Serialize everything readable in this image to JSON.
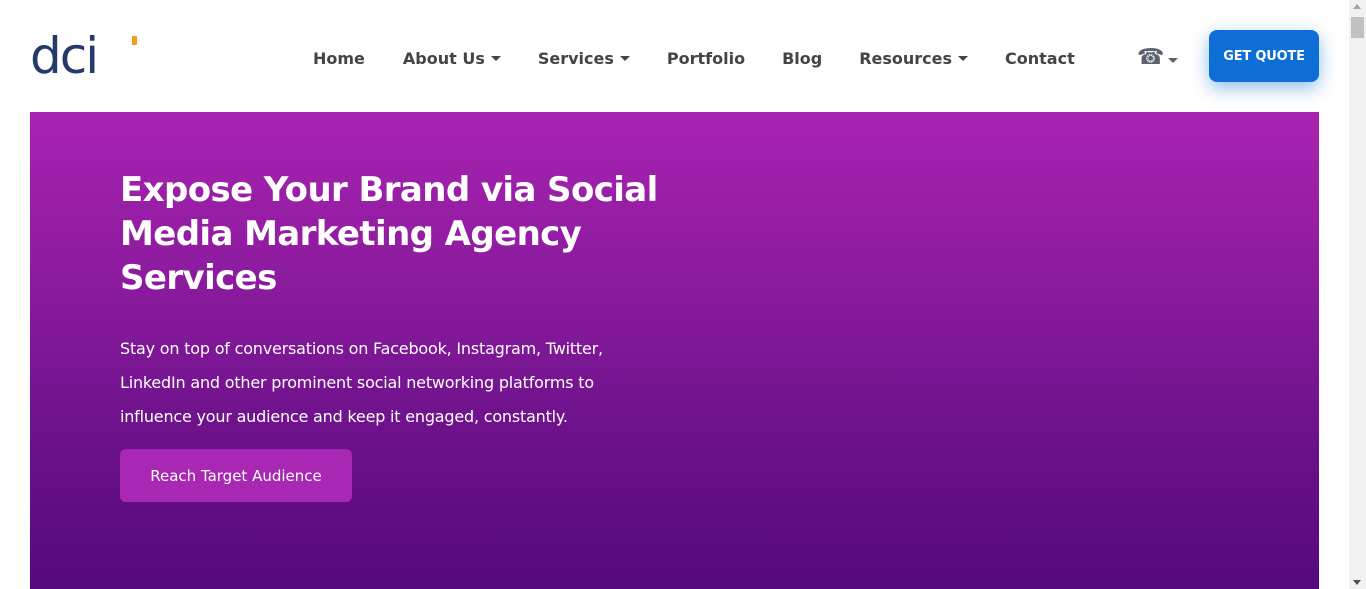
{
  "header": {
    "logo_text": "dci",
    "nav": [
      {
        "label": "Home",
        "dropdown": false
      },
      {
        "label": "About Us",
        "dropdown": true
      },
      {
        "label": "Services",
        "dropdown": true
      },
      {
        "label": "Portfolio",
        "dropdown": false
      },
      {
        "label": "Blog",
        "dropdown": false
      },
      {
        "label": "Resources",
        "dropdown": true
      },
      {
        "label": "Contact",
        "dropdown": false
      }
    ],
    "phone_icon": "☎",
    "quote_button": "GET QUOTE"
  },
  "hero": {
    "title": "Expose Your Brand via Social Media Marketing Agency Services",
    "description": "Stay on top of conversations on Facebook, Instagram, Twitter, LinkedIn and other prominent social networking platforms to influence your audience and keep it engaged, constantly.",
    "cta": "Reach Target Audience"
  },
  "colors": {
    "brand_navy": "#233a6a",
    "accent_orange": "#f39a1f",
    "quote_blue": "#0d6ed6",
    "hero_top": "#a823b0",
    "hero_bottom": "#55097c",
    "cta_purple": "#a827b3"
  },
  "icons": {
    "phone": "phone-icon",
    "dropdown": "chevron-down-icon"
  }
}
